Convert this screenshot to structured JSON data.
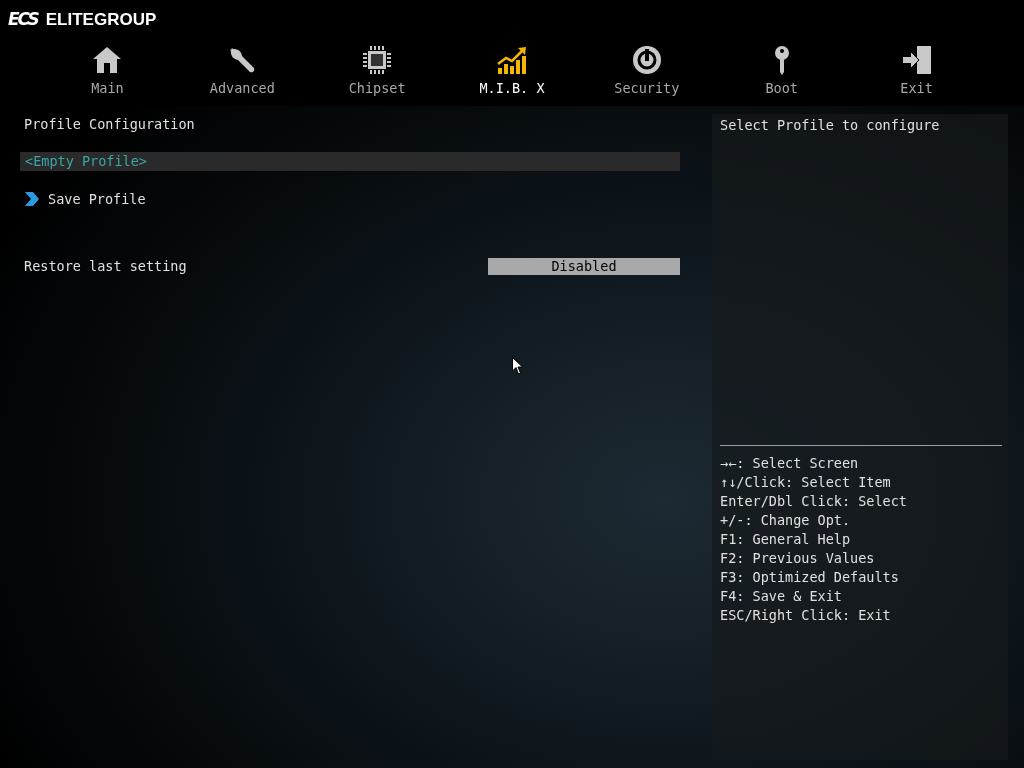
{
  "logo": {
    "mark": "ECS",
    "name": "ELITEGROUP"
  },
  "tabs": [
    {
      "label": "Main",
      "kind": "home",
      "selected": false
    },
    {
      "label": "Advanced",
      "kind": "wrench",
      "selected": false
    },
    {
      "label": "Chipset",
      "kind": "chip",
      "selected": false
    },
    {
      "label": "M.I.B. X",
      "kind": "chart",
      "selected": true
    },
    {
      "label": "Security",
      "kind": "power",
      "selected": false
    },
    {
      "label": "Boot",
      "kind": "key",
      "selected": false
    },
    {
      "label": "Exit",
      "kind": "exit",
      "selected": false
    }
  ],
  "section_title": "Profile Configuration",
  "rows": [
    {
      "kind": "item",
      "label": "<Empty Profile>",
      "selected": true
    },
    {
      "kind": "submenu",
      "label": "Save Profile",
      "selected": false
    },
    {
      "kind": "option",
      "label": "Restore last setting",
      "value": "Disabled",
      "selected": false
    }
  ],
  "help": {
    "description": "Select Profile to configure",
    "keys": [
      "→←: Select Screen",
      "↑↓/Click: Select Item",
      "Enter/Dbl Click: Select",
      "+/-: Change Opt.",
      "F1: General Help",
      "F2: Previous Values",
      "F3: Optimized Defaults",
      "F4: Save & Exit",
      "ESC/Right Click: Exit"
    ]
  }
}
